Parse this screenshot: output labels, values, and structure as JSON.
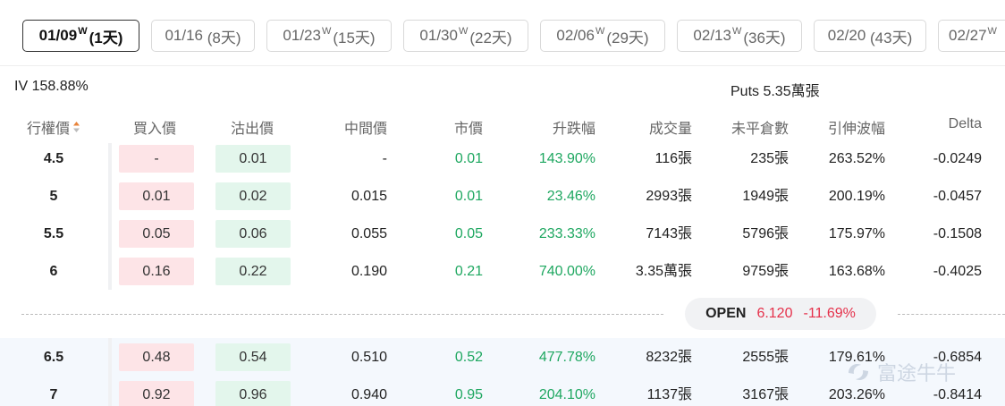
{
  "tabs": [
    {
      "date": "01/09",
      "weekly": "W",
      "days": "(1天)"
    },
    {
      "date": "01/16",
      "weekly": "",
      "days": "(8天)"
    },
    {
      "date": "01/23",
      "weekly": "W",
      "days": "(15天)"
    },
    {
      "date": "01/30",
      "weekly": "W",
      "days": "(22天)"
    },
    {
      "date": "02/06",
      "weekly": "W",
      "days": "(29天)"
    },
    {
      "date": "02/13",
      "weekly": "W",
      "days": "(36天)"
    },
    {
      "date": "02/20",
      "weekly": "",
      "days": "(43天)"
    },
    {
      "date": "02/27",
      "weekly": "W",
      "days": ""
    }
  ],
  "info": {
    "iv": "IV 158.88%",
    "puts": "Puts 5.35萬張"
  },
  "headers": {
    "strike": "行權價",
    "bid": "買入價",
    "ask": "沽出價",
    "mid": "中間價",
    "last": "市價",
    "change": "升跌幅",
    "volume": "成交量",
    "open_interest": "未平倉數",
    "iv": "引伸波幅",
    "delta": "Delta"
  },
  "rows_top": [
    {
      "strike": "4.5",
      "bid": "-",
      "ask": "0.01",
      "mid": "-",
      "last": "0.01",
      "change": "143.90%",
      "volume": "116張",
      "oi": "235張",
      "iv": "263.52%",
      "delta": "-0.0249"
    },
    {
      "strike": "5",
      "bid": "0.01",
      "ask": "0.02",
      "mid": "0.015",
      "last": "0.01",
      "change": "23.46%",
      "volume": "2993張",
      "oi": "1949張",
      "iv": "200.19%",
      "delta": "-0.0457"
    },
    {
      "strike": "5.5",
      "bid": "0.05",
      "ask": "0.06",
      "mid": "0.055",
      "last": "0.05",
      "change": "233.33%",
      "volume": "7143張",
      "oi": "5796張",
      "iv": "175.97%",
      "delta": "-0.1508"
    },
    {
      "strike": "6",
      "bid": "0.16",
      "ask": "0.22",
      "mid": "0.190",
      "last": "0.21",
      "change": "740.00%",
      "volume": "3.35萬張",
      "oi": "9759張",
      "iv": "163.68%",
      "delta": "-0.4025"
    }
  ],
  "underlying": {
    "label": "OPEN",
    "price": "6.120",
    "change": "-11.69%"
  },
  "rows_bottom": [
    {
      "strike": "6.5",
      "bid": "0.48",
      "ask": "0.54",
      "mid": "0.510",
      "last": "0.52",
      "change": "477.78%",
      "volume": "8232張",
      "oi": "2555張",
      "iv": "179.61%",
      "delta": "-0.6854"
    },
    {
      "strike": "7",
      "bid": "0.92",
      "ask": "0.96",
      "mid": "0.940",
      "last": "0.95",
      "change": "204.10%",
      "volume": "1137張",
      "oi": "3167張",
      "iv": "203.26%",
      "delta": "-0.8414"
    }
  ],
  "watermark": "富途牛牛",
  "colors": {
    "up": "#1ea760",
    "down": "#e5304a",
    "bid_bg": "#fde4e7",
    "ask_bg": "#e3f6ec"
  }
}
